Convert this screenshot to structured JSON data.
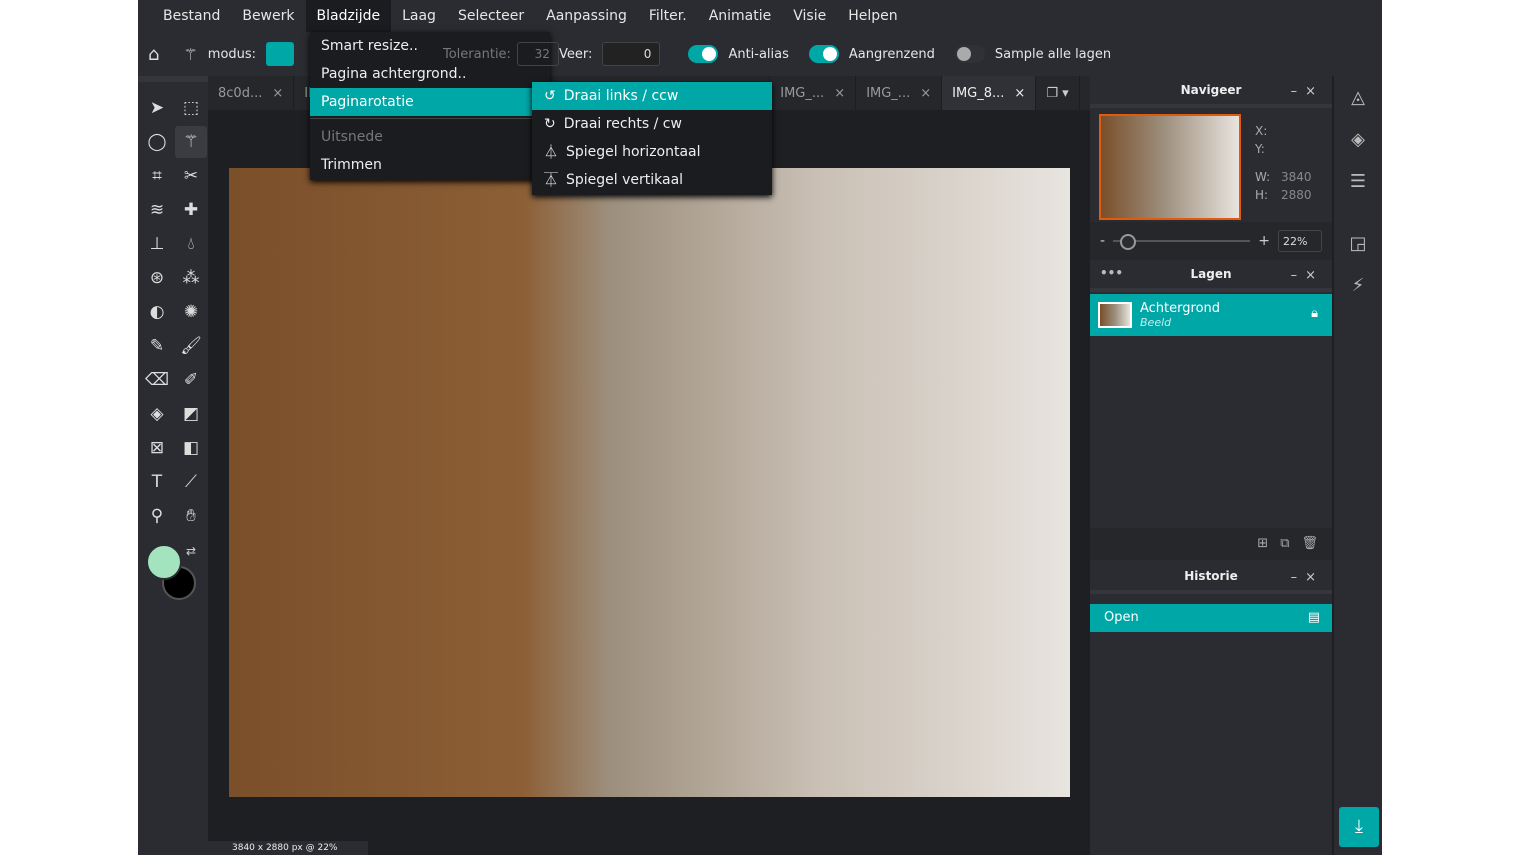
{
  "menubar": {
    "items": [
      "Bestand",
      "Bewerk",
      "Bladzijde",
      "Laag",
      "Selecteer",
      "Aanpassing",
      "Filter.",
      "Animatie",
      "Visie",
      "Helpen"
    ],
    "active": "Bladzijde"
  },
  "toolbar": {
    "mode_label": "modus:",
    "tolerance_label": "Tolerantie:",
    "tolerance_value": "32",
    "feather_label": "Veer:",
    "feather_value": "0",
    "antialias_label": "Anti-alias",
    "antialias_on": true,
    "contiguous_label": "Aangrenzend",
    "contiguous_on": true,
    "sample_label": "Sample alle lagen",
    "sample_on": false
  },
  "tabs": [
    {
      "label": "8c0d...",
      "active": false
    },
    {
      "label": "IM",
      "active": false
    },
    {
      "label": "IMG_...",
      "active": false
    },
    {
      "label": "IMG_...",
      "active": false
    },
    {
      "label": "IMG_8...",
      "active": true
    }
  ],
  "dropdown": {
    "items": [
      {
        "label": "Smart resize..",
        "state": "normal"
      },
      {
        "label": "Pagina achtergrond..",
        "state": "normal"
      },
      {
        "label": "Paginarotatie",
        "state": "highlight"
      },
      {
        "label": "Uitsnede",
        "state": "disabled"
      },
      {
        "label": "Trimmen",
        "state": "normal"
      }
    ]
  },
  "submenu": {
    "items": [
      {
        "label": "Draai links / ccw",
        "icon": "rotate-ccw-icon"
      },
      {
        "label": "Draai rechts / cw",
        "icon": "rotate-cw-icon"
      },
      {
        "label": "Spiegel horizontaal",
        "icon": "flip-horizontal-icon"
      },
      {
        "label": "Spiegel vertikaal",
        "icon": "flip-vertical-icon"
      }
    ]
  },
  "status": "3840 x 2880 px @ 22%",
  "navigator": {
    "title": "Navigeer",
    "x_label": "X:",
    "y_label": "Y:",
    "w_label": "W:",
    "w": "3840",
    "h_label": "H:",
    "h": "2880",
    "zoom": "22%",
    "zoom_percent": 22
  },
  "layers": {
    "title": "Lagen",
    "items": [
      {
        "name": "Achtergrond",
        "type": "Beeld",
        "locked": true
      }
    ]
  },
  "history": {
    "title": "Historie",
    "items": [
      "Open"
    ]
  },
  "colors": {
    "accent": "#00a7a7",
    "foreground": "#a3e4bf",
    "background": "#000000"
  }
}
